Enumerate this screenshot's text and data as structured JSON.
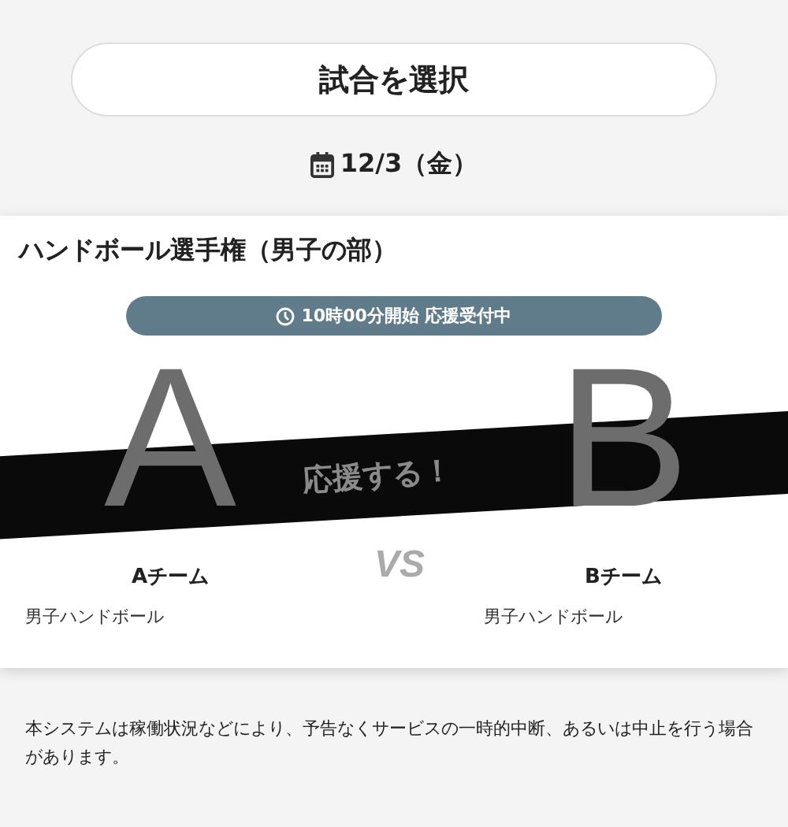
{
  "header_button": {
    "label": "試合を選択"
  },
  "date": "12/3（金）",
  "match": {
    "title": "ハンドボール選手権（男子の部）",
    "status": "10時00分開始 応援受付中",
    "teams": [
      {
        "letter": "A",
        "name": "Aチーム",
        "category": "男子ハンドボール"
      },
      {
        "letter": "B",
        "name": "Bチーム",
        "category": "男子ハンドボール"
      }
    ],
    "versus": "VS",
    "cheer_button": "応援する！"
  },
  "notice": "本システムは稼働状況などにより、予告なくサービスの一時的中断、あるいは中止を行う場合があります。"
}
